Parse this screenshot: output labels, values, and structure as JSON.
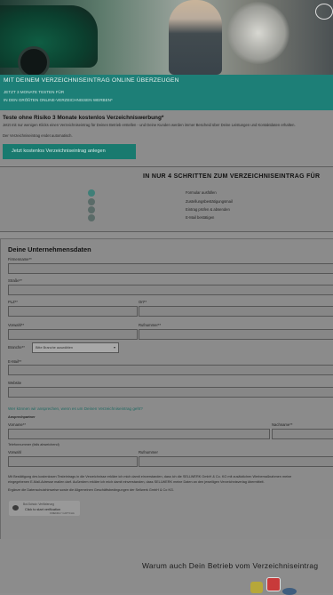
{
  "banner": {
    "headline": "MIT DEINEM VERZEICHNISEINTRAG ONLINE ÜBERZEUGEN",
    "line1": "JETZT 3 MONATE TESTEN FÜR",
    "line2": "IN DEN GRÖßTEN ONLINE-VERZEICHNISSEN WERBEN*"
  },
  "intro": {
    "heading": "Teste ohne Risiko 3 Monate kostenlos Verzeichniswerbung*",
    "paragraph": "Jetzt mit nur wenigen Klicks einen Verzeichniseintrag für Deinen Betrieb erstellen - und Deine Kunden werden immer Bescheid über Deine Leistungen und Kontaktdaten erhalten.",
    "note": "Der Verzeichniseintrag endet automatisch.",
    "cta_label": "Jetzt kostenlos Verzeichniseintrag anlegen"
  },
  "steps": {
    "heading": "IN NUR 4 SCHRITTEN ZUM VERZEICHNISEINTRAG FÜR",
    "items": [
      "Formular ausfüllen",
      "Zustellungsbestätigungsmail",
      "Eintrag prüfen & absenden",
      "E-Mail bestätigen"
    ]
  },
  "form": {
    "heading": "Deine Unternehmensdaten",
    "firm_label": "Firmenname**",
    "street_label": "Straße**",
    "zip_label": "PLZ**",
    "city_label": "Ort**",
    "prefix_label": "Vorwahl**",
    "phone_label": "Rufnummer**",
    "branch_label": "Branche**",
    "branch_select": "Bitte Branche auswählen",
    "email_label": "E-Mail**",
    "website_label": "Website",
    "contact_question": "Wer können wir ansprechen, wenn es um Deinen Verzeichniseintrag geht?",
    "contact_heading": "Ansprechpartner",
    "firstname_label": "Vorname**",
    "lastname_label": "Nachname**",
    "phone_optional_label": "Telefonnummer (falls abweichend)",
    "prefix2_label": "Vorwahl",
    "phone2_label": "Rufnummer",
    "consent1": "Mit Bestätigung des kostenlosen Testeintrags in die Verzeichnisse erkläre ich mich damit einverstanden, dass ich die SELLWERK GmbH & Co. KG mit zusätzlichen Werbemaßnahmen meine",
    "consent2": "eingegebenen E-Mail-Adresse mailen darf. Außerdem erkläre ich mich damit einverstanden, dass SELLWERK meine Daten an den jeweiligen Verzeichnisverlag übermittelt.",
    "consent3": "Ergänze die Datenschutzhinweise sowie die Allgemeinen Geschäftsbedingungen der Sellwerk GmbH & Co KG.",
    "captcha_top": "Bot-Schutz: Verifizierung",
    "captcha_main": "Click to start verification",
    "captcha_brand": "FRIENDLY CAPTCHA"
  },
  "bottom": {
    "heading": "Warum auch Dein Betrieb vom Verzeichniseintrag"
  }
}
